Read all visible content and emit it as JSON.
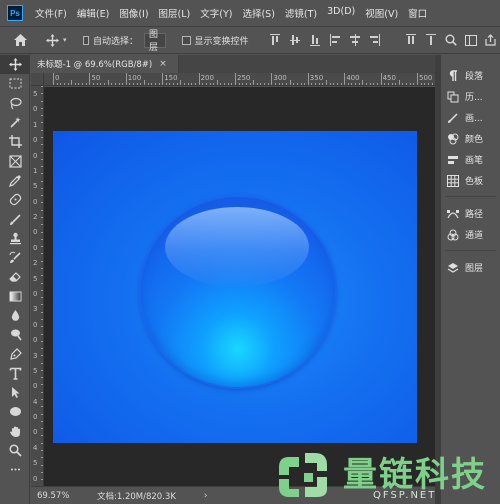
{
  "app": {
    "logo_text": "Ps"
  },
  "menu": [
    "文件(F)",
    "编辑(E)",
    "图像(I)",
    "图层(L)",
    "文字(Y)",
    "选择(S)",
    "滤镜(T)",
    "3D(D)",
    "视图(V)",
    "窗口"
  ],
  "options_bar": {
    "auto_select_label": "自动选择：",
    "auto_select_value": "图层",
    "show_transform_label": "显示变换控件"
  },
  "document": {
    "tab_title": "未标题-1 @ 69.6%(RGB/8#)",
    "close_glyph": "×"
  },
  "ruler": {
    "h_labels": [
      "0",
      "50",
      "100",
      "150",
      "200",
      "250",
      "300",
      "350",
      "400",
      "450",
      "500"
    ],
    "v_labels": [
      "5",
      "0",
      "1",
      "0",
      "0",
      "1",
      "5",
      "0",
      "2",
      "0",
      "0",
      "2",
      "5",
      "0",
      "3",
      "0",
      "0",
      "3",
      "5",
      "0",
      "4",
      "0",
      "0",
      "4",
      "5",
      "0"
    ]
  },
  "status": {
    "zoom": "69.57%",
    "doc_info": "文档:1.20M/820.3K",
    "arrow": "›"
  },
  "panels": [
    {
      "icon": "paragraph-icon",
      "label": "段落"
    },
    {
      "icon": "history-icon",
      "label": "历..."
    },
    {
      "icon": "brush-panel-icon",
      "label": "画..."
    },
    {
      "icon": "color-icon",
      "label": "颜色"
    },
    {
      "icon": "brushes-icon",
      "label": "画笔"
    },
    {
      "icon": "swatches-icon",
      "label": "色板"
    },
    {
      "icon": "paths-icon",
      "label": "路径"
    },
    {
      "icon": "channels-icon",
      "label": "通道"
    },
    {
      "icon": "layers-icon",
      "label": "图层"
    }
  ],
  "watermark": {
    "title": "量链科技",
    "subtitle": "QFSP.NET"
  },
  "colors": {
    "canvas_blue": "#1470f0",
    "sphere_center": "#19d7ff",
    "ui_gray": "#535353"
  }
}
